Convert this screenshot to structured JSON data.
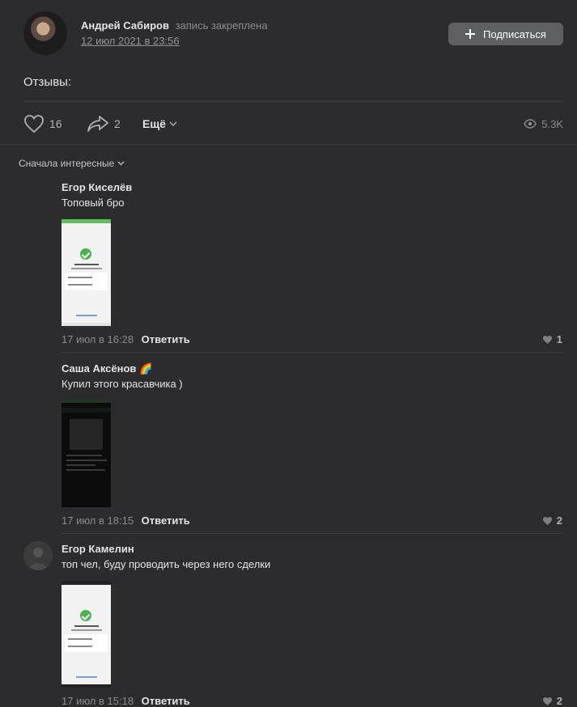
{
  "post": {
    "author": "Андрей Сабиров",
    "pinned_label": "запись закреплена",
    "date": "12 июл 2021 в 23:56",
    "subscribe_label": "Подписаться",
    "text": "Отзывы:",
    "likes": "16",
    "shares": "2",
    "more_label": "Ещё",
    "views": "5.3K"
  },
  "sort_label": "Сначала интересные",
  "comments": [
    {
      "author": "Егор Киселёв",
      "text": "Топовый бро",
      "date": "17 июл в 16:28",
      "reply_label": "Ответить",
      "likes": "1",
      "has_avatar": false,
      "image": "light-screenshot"
    },
    {
      "author": "Саша Аксёнов 🌈",
      "text": "Купил этого красавчика )",
      "date": "17 июл в 18:15",
      "reply_label": "Ответить",
      "likes": "2",
      "has_avatar": false,
      "image": "dark-screenshot"
    },
    {
      "author": "Егор Камелин",
      "text": "топ чел, буду проводить через него сделки",
      "date": "17 июл в 15:18",
      "reply_label": "Ответить",
      "likes": "2",
      "has_avatar": true,
      "image": "light-screenshot"
    }
  ],
  "icons": {
    "like": "heart-icon",
    "share": "share-arrow-icon",
    "views": "eye-icon",
    "chevron": "chevron-down-icon"
  },
  "colors": {
    "background": "#2c2c2e",
    "text": "#e1e3e6",
    "muted": "#8a8c8f",
    "button": "#5e5f61",
    "accent_green": "#4bb34b"
  }
}
